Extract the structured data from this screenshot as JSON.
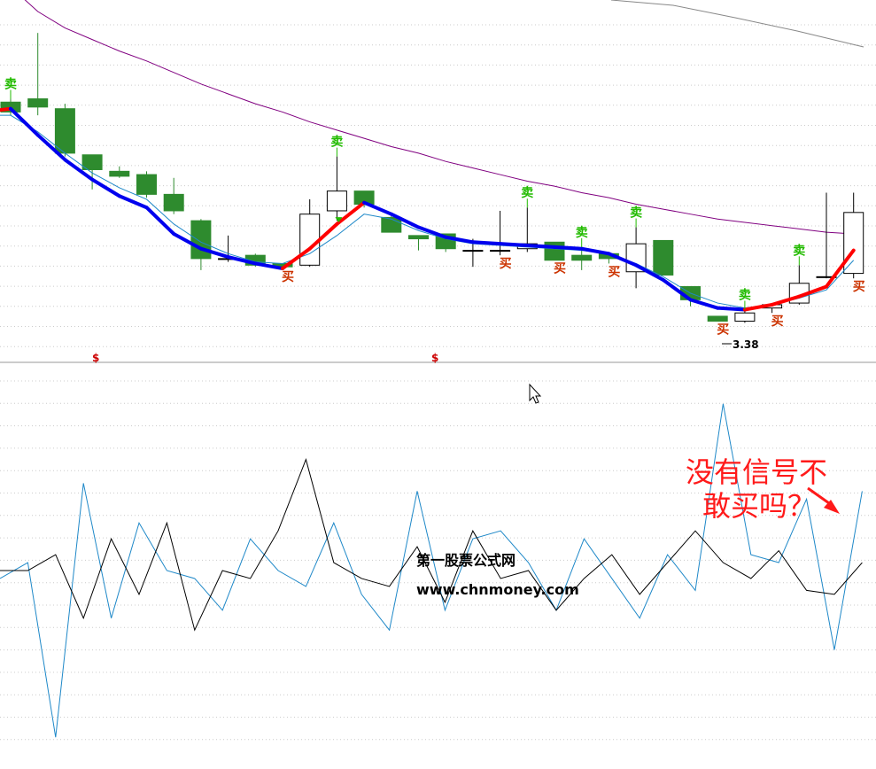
{
  "colors": {
    "bull": "#000000",
    "bear": "#2e8b2e",
    "up_trend": "#ff0000",
    "down_trend": "#0000ee",
    "ma_short": "#1e88c8",
    "ma_long": "#800080",
    "ma_top": "#888888",
    "sell": "#22bb00",
    "buy": "#cc3300",
    "osc_a": "#1e88c8",
    "osc_b": "#000000",
    "grid": "#cccccc",
    "annotation": "#ff1a1a"
  },
  "labels": {
    "sell": "卖",
    "buy": "买",
    "dollar": "$",
    "low_price": "3.38",
    "watermark_line1": "第一股票公式网",
    "watermark_line2": "www.chnmoney.com",
    "annotation_line1": "没有信号不",
    "annotation_line2": "敢买吗？"
  },
  "chart_data": [
    {
      "type": "candlestick",
      "price_ylim": [
        3.2,
        5.4
      ],
      "candles": [
        {
          "o": 4.78,
          "c": 4.72,
          "h": 4.8,
          "l": 4.7
        },
        {
          "o": 4.8,
          "c": 4.75,
          "h": 5.2,
          "l": 4.7
        },
        {
          "o": 4.74,
          "c": 4.47,
          "h": 4.77,
          "l": 4.45
        },
        {
          "o": 4.46,
          "c": 4.37,
          "h": 4.46,
          "l": 4.25
        },
        {
          "o": 4.36,
          "c": 4.33,
          "h": 4.39,
          "l": 4.32
        },
        {
          "o": 4.34,
          "c": 4.22,
          "h": 4.36,
          "l": 4.2
        },
        {
          "o": 4.22,
          "c": 4.12,
          "h": 4.32,
          "l": 4.1
        },
        {
          "o": 4.06,
          "c": 3.83,
          "h": 4.07,
          "l": 3.76
        },
        {
          "o": 3.83,
          "c": 3.83,
          "h": 3.97,
          "l": 3.81
        },
        {
          "o": 3.85,
          "c": 3.79,
          "h": 3.86,
          "l": 3.78
        },
        {
          "o": 3.8,
          "c": 3.78,
          "h": 3.8,
          "l": 3.77
        },
        {
          "o": 3.79,
          "c": 4.1,
          "h": 4.19,
          "l": 3.78
        },
        {
          "o": 4.12,
          "c": 4.24,
          "h": 4.45,
          "l": 4.06
        },
        {
          "o": 4.24,
          "c": 4.16,
          "h": 4.24,
          "l": 4.14
        },
        {
          "o": 4.08,
          "c": 3.99,
          "h": 4.09,
          "l": 3.99
        },
        {
          "o": 3.97,
          "c": 3.95,
          "h": 3.97,
          "l": 3.88
        },
        {
          "o": 3.98,
          "c": 3.89,
          "h": 3.98,
          "l": 3.87
        },
        {
          "o": 3.88,
          "c": 3.88,
          "h": 3.95,
          "l": 3.78
        },
        {
          "o": 3.88,
          "c": 3.88,
          "h": 4.12,
          "l": 3.85
        },
        {
          "o": 3.89,
          "c": 3.92,
          "h": 4.14,
          "l": 3.87
        },
        {
          "o": 3.93,
          "c": 3.82,
          "h": 3.93,
          "l": 3.82
        },
        {
          "o": 3.85,
          "c": 3.82,
          "h": 3.9,
          "l": 3.76
        },
        {
          "o": 3.86,
          "c": 3.83,
          "h": 3.86,
          "l": 3.8
        },
        {
          "o": 3.75,
          "c": 3.92,
          "h": 4.02,
          "l": 3.65
        },
        {
          "o": 3.94,
          "c": 3.73,
          "h": 3.94,
          "l": 3.73
        },
        {
          "o": 3.66,
          "c": 3.58,
          "h": 3.66,
          "l": 3.54
        },
        {
          "o": 3.48,
          "c": 3.45,
          "h": 3.48,
          "l": 3.45
        },
        {
          "o": 3.45,
          "c": 3.5,
          "h": 3.52,
          "l": 3.44
        },
        {
          "o": 3.53,
          "c": 3.55,
          "h": 3.56,
          "l": 3.5
        },
        {
          "o": 3.56,
          "c": 3.68,
          "h": 3.79,
          "l": 3.55
        },
        {
          "o": 3.72,
          "c": 3.72,
          "h": 4.23,
          "l": 3.71
        },
        {
          "o": 3.74,
          "c": 4.11,
          "h": 4.23,
          "l": 3.71
        }
      ],
      "trend_line": [
        4.72,
        4.74,
        4.58,
        4.43,
        4.31,
        4.21,
        4.14,
        3.98,
        3.89,
        3.84,
        3.8,
        3.77,
        3.89,
        4.04,
        4.17,
        4.1,
        4.02,
        3.96,
        3.93,
        3.92,
        3.91,
        3.9,
        3.89,
        3.86,
        3.79,
        3.7,
        3.58,
        3.53,
        3.52,
        3.55,
        3.6,
        3.66,
        3.88
      ],
      "ma_short": [
        4.7,
        4.7,
        4.6,
        4.47,
        4.35,
        4.26,
        4.19,
        4.04,
        3.93,
        3.86,
        3.81,
        3.8,
        3.86,
        3.97,
        4.1,
        4.07,
        4.0,
        3.95,
        3.92,
        3.91,
        3.9,
        3.89,
        3.88,
        3.86,
        3.8,
        3.72,
        3.62,
        3.56,
        3.53,
        3.55,
        3.59,
        3.64,
        3.82
      ],
      "ma_long": [
        5.6,
        5.48,
        5.33,
        5.23,
        5.16,
        5.09,
        5.03,
        4.96,
        4.89,
        4.83,
        4.77,
        4.72,
        4.66,
        4.61,
        4.56,
        4.51,
        4.47,
        4.42,
        4.38,
        4.34,
        4.3,
        4.27,
        4.23,
        4.2,
        4.16,
        4.13,
        4.1,
        4.07,
        4.05,
        4.03,
        4.01,
        3.99,
        3.98
      ],
      "signals": [
        {
          "i": 0,
          "type": "sell"
        },
        {
          "i": 12,
          "type": "sell"
        },
        {
          "i": 19,
          "type": "sell"
        },
        {
          "i": 21,
          "type": "sell"
        },
        {
          "i": 23,
          "type": "sell"
        },
        {
          "i": 27,
          "type": "sell"
        },
        {
          "i": 29,
          "type": "sell"
        },
        {
          "i": 10,
          "type": "buy"
        },
        {
          "i": 18,
          "type": "buy"
        },
        {
          "i": 20,
          "type": "buy"
        },
        {
          "i": 22,
          "type": "buy"
        },
        {
          "i": 26,
          "type": "buy"
        },
        {
          "i": 28,
          "type": "buy"
        },
        {
          "i": 31,
          "type": "buy"
        }
      ],
      "low_label_price": 3.38
    },
    {
      "type": "line",
      "ylim": [
        0,
        100
      ],
      "series": [
        {
          "values": [
            48,
            52,
            8,
            72,
            38,
            62,
            50,
            48,
            40,
            58,
            50,
            46,
            62,
            44,
            35,
            70,
            40,
            58,
            60,
            52,
            40,
            58,
            48,
            38,
            54,
            45,
            92,
            54,
            52,
            68,
            30,
            70
          ]
        },
        {
          "values": [
            50,
            50,
            54,
            38,
            58,
            44,
            62,
            35,
            50,
            48,
            60,
            78,
            52,
            48,
            46,
            56,
            42,
            60,
            48,
            50,
            40,
            48,
            54,
            44,
            52,
            60,
            52,
            48,
            55,
            45,
            44,
            52
          ]
        }
      ]
    }
  ]
}
